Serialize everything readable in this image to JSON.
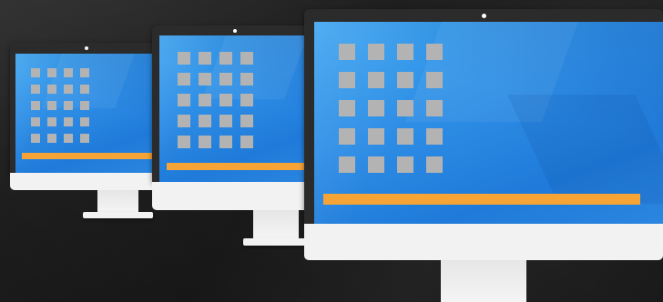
{
  "scene": {
    "subject": "desktop-monitors",
    "monitor_count": 3,
    "colors": {
      "background": "#1e1e1e",
      "bezel": "#2b2b2b",
      "screen": "#2f8fe6",
      "icon_tile": "#b3b3b3",
      "taskbar": "#f6a436",
      "stand": "#f2f2f2"
    }
  },
  "monitors": [
    {
      "name": "small",
      "icon_rows": 5,
      "icon_cols": 4
    },
    {
      "name": "medium",
      "icon_rows": 5,
      "icon_cols": 4
    },
    {
      "name": "large",
      "icon_rows": 5,
      "icon_cols": 4
    }
  ]
}
